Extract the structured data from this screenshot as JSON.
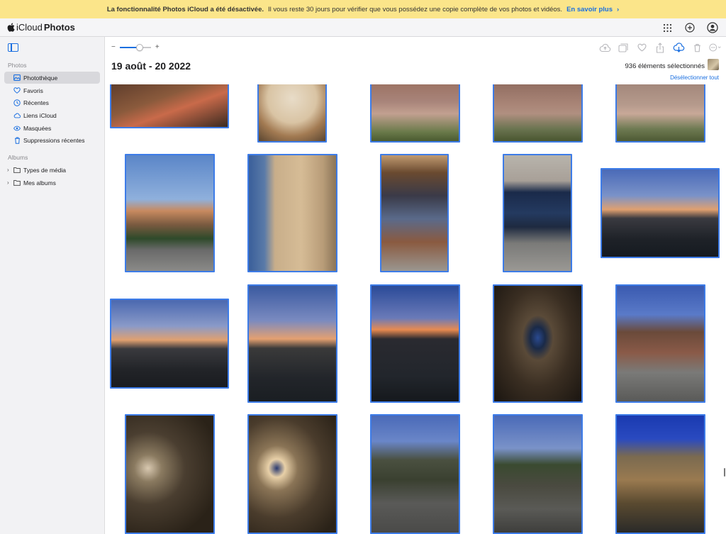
{
  "banner": {
    "bold_text": "La fonctionnalité Photos iCloud a été désactivée.",
    "text": "Il vous reste 30 jours pour vérifier que vous possédez une copie complète de vos photos et vidéos.",
    "link": "En savoir plus",
    "link_chevron": "›"
  },
  "app": {
    "icloud": "iCloud",
    "photos": "Photos"
  },
  "topbar_icons": [
    "apps-grid-icon",
    "add-icon",
    "account-icon"
  ],
  "sidebar": {
    "photos_header": "Photos",
    "items": [
      {
        "label": "Photothèque",
        "icon": "library-icon",
        "active": true
      },
      {
        "label": "Favoris",
        "icon": "heart-icon"
      },
      {
        "label": "Récentes",
        "icon": "clock-icon"
      },
      {
        "label": "Liens iCloud",
        "icon": "cloud-link-icon"
      },
      {
        "label": "Masquées",
        "icon": "eye-icon"
      },
      {
        "label": "Suppressions récentes",
        "icon": "trash-icon"
      }
    ],
    "albums_header": "Albums",
    "albums": [
      {
        "label": "Types de média",
        "icon": "folder-icon"
      },
      {
        "label": "Mes albums",
        "icon": "folder-icon"
      }
    ]
  },
  "main": {
    "zoom_minus": "−",
    "zoom_plus": "+",
    "zoom_level": 0.65,
    "date_title": "19 août - 20 2022",
    "selection_count": "936 éléments sélectionnés",
    "deselect_all": "Désélectionner tout",
    "toolbar_icons": [
      "upload-icon",
      "add-to-album-icon",
      "favorite-icon",
      "share-icon",
      "download-icon",
      "delete-icon",
      "more-icon"
    ]
  },
  "colors": {
    "selection": "#3d7ce8",
    "accent": "#1a6fe0",
    "banner": "#fbe58a"
  }
}
